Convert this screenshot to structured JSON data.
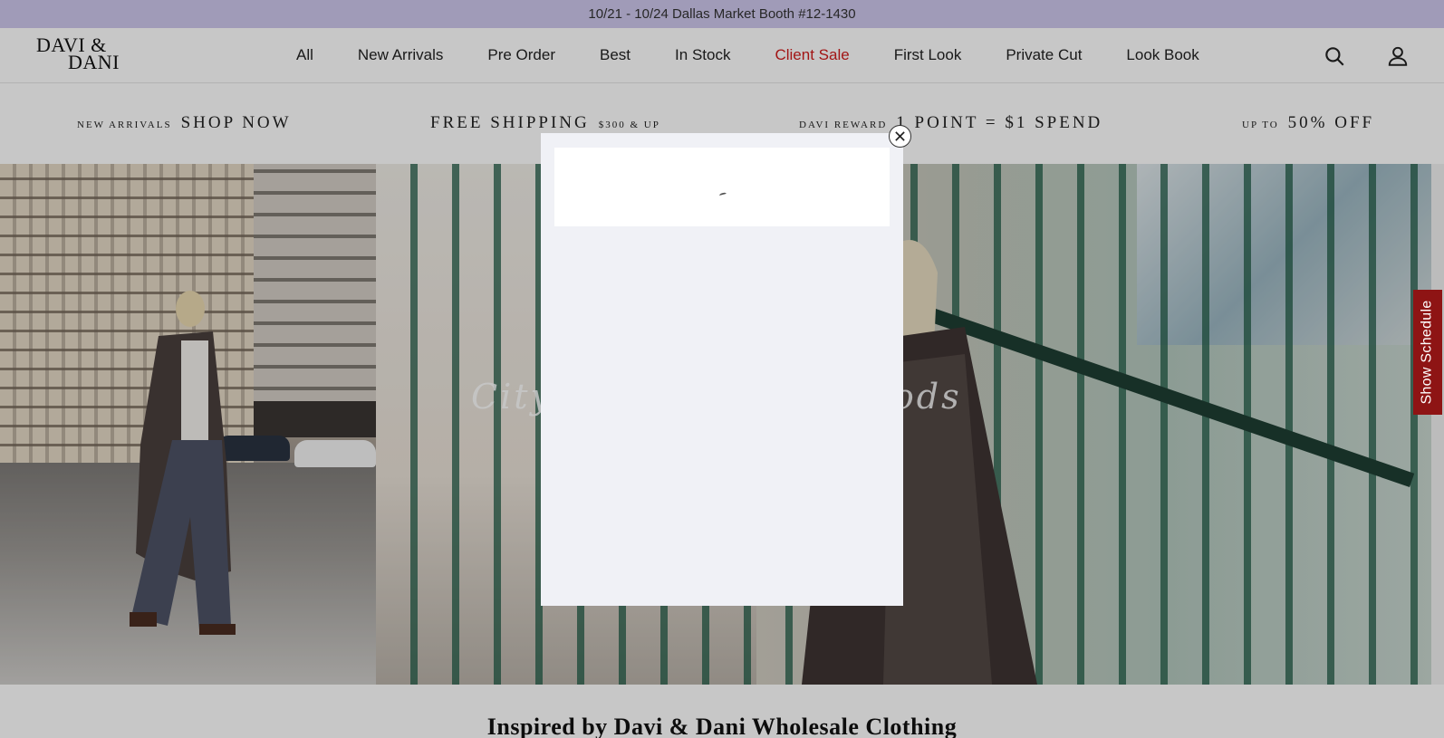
{
  "announcement": {
    "text": "10/21 - 10/24 Dallas Market Booth #12-1430"
  },
  "header": {
    "logo_line1": "DAVI &",
    "logo_line2": "DANI",
    "nav": [
      {
        "label": "All"
      },
      {
        "label": "New Arrivals"
      },
      {
        "label": "Pre Order"
      },
      {
        "label": "Best"
      },
      {
        "label": "In Stock"
      },
      {
        "label": "Client Sale",
        "highlight": "#d01c1c"
      },
      {
        "label": "First Look"
      },
      {
        "label": "Private Cut"
      },
      {
        "label": "Look Book"
      }
    ],
    "icons": {
      "search": "search-icon",
      "account": "account-icon"
    }
  },
  "promo": [
    {
      "small": "New Arrivals",
      "big": "Shop Now"
    },
    {
      "big": "Free Shipping",
      "small": "$300 & up"
    },
    {
      "small": "Davi Reward",
      "big": "1 Point = $1 Spend"
    },
    {
      "small": "Up to",
      "big": "50% Off"
    }
  ],
  "hero": {
    "script_left": "City",
    "script_right": "oods"
  },
  "section": {
    "title": "Inspired by Davi & Dani Wholesale Clothing"
  },
  "side_tab": {
    "label": "Show Schedule",
    "color": "#8e1414"
  },
  "modal": {
    "close_icon": "close-icon",
    "loading_indicator": "spinner"
  },
  "colors": {
    "announcement_bg": "#cdc7ec",
    "sale_red": "#d01c1c"
  }
}
